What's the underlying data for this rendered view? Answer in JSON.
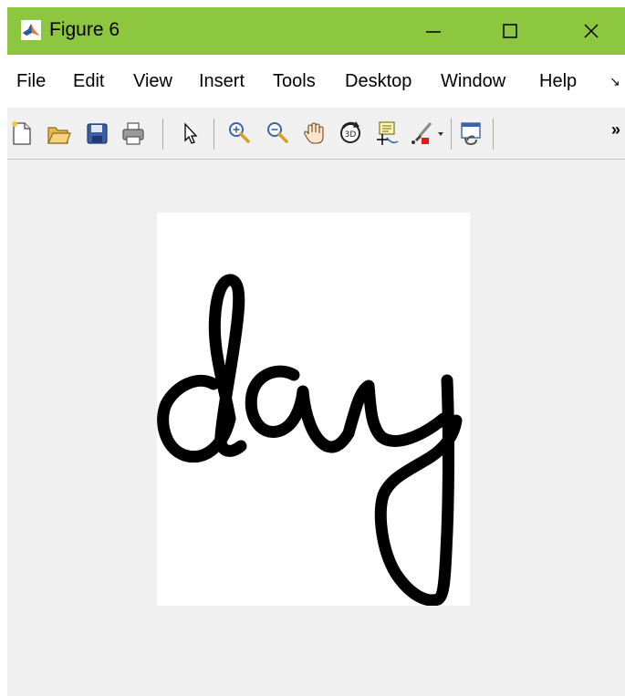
{
  "window": {
    "title": "Figure 6",
    "titlebar_color": "#8dc63f",
    "controls": [
      "minimize-icon",
      "maximize-icon",
      "close-icon"
    ]
  },
  "menu": {
    "items": [
      "File",
      "Edit",
      "View",
      "Insert",
      "Tools",
      "Desktop",
      "Window",
      "Help"
    ],
    "more_icon": "menu-overflow-arrow"
  },
  "toolbar": {
    "tools": [
      "new-figure-icon",
      "open-file-icon",
      "save-icon",
      "print-icon",
      "pointer-icon",
      "zoom-in-icon",
      "zoom-out-icon",
      "pan-hand-icon",
      "rotate-3d-icon",
      "data-cursor-icon",
      "brush-icon",
      "brush-dropdown-icon",
      "link-plot-icon"
    ],
    "overflow": "»"
  },
  "figure": {
    "content": "handwritten word image",
    "handwriting_text": "day",
    "background": "#f0f0f0",
    "image_background": "#ffffff",
    "ink_color": "#000000"
  }
}
